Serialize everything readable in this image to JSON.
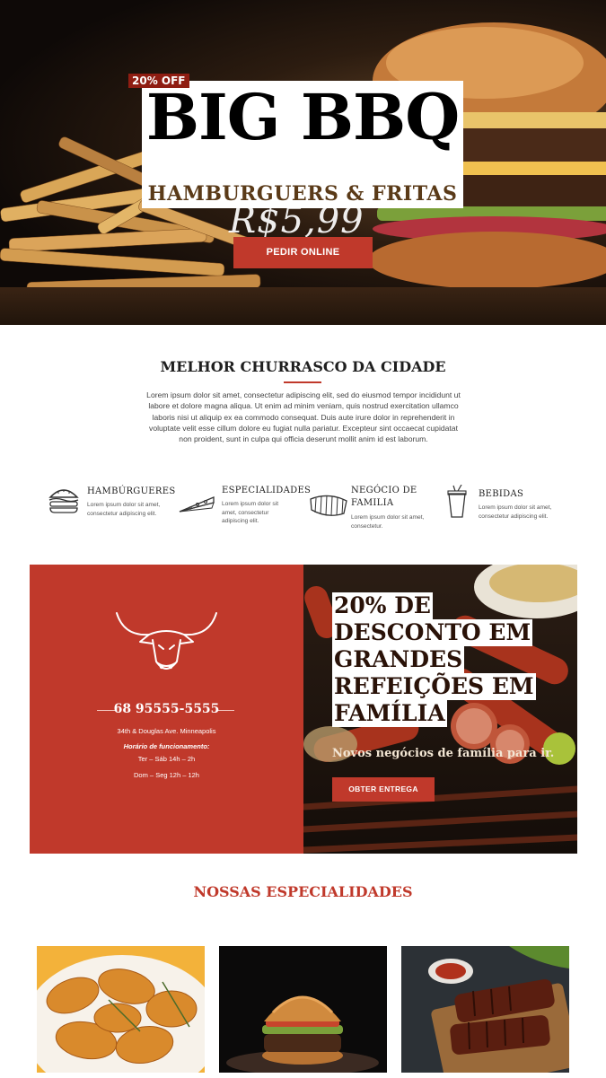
{
  "hero": {
    "badge": "20% OFF",
    "title": "BIG BBQ",
    "subtitle": "HAMBURGUERS & FRITAS",
    "price": "R$5,99",
    "button": "PEDIR ONLINE"
  },
  "intro": {
    "title": "MELHOR CHURRASCO DA CIDADE",
    "text": "Lorem ipsum dolor sit amet, consectetur adipiscing elit, sed do eiusmod tempor incididunt ut labore et dolore magna aliqua. Ut enim ad minim veniam, quis nostrud exercitation ullamco laboris nisi ut aliquip ex ea commodo consequat. Duis aute irure dolor in reprehenderit in voluptate velit esse cillum dolore eu fugiat nulla pariatur. Excepteur sint occaecat cupidatat non proident, sunt in culpa qui officia deserunt mollit anim id est laborum."
  },
  "features": [
    {
      "icon": "burger-icon",
      "title": "HAMBÚRGUERES",
      "text": "Lorem ipsum dolor sit amet, consectetur adipiscing elit."
    },
    {
      "icon": "pizza-slice-icon",
      "title": "ESPECIALIDADES",
      "text": "Lorem ipsum dolor sit amet, consectetur adipiscing elit."
    },
    {
      "icon": "ribs-icon",
      "title": "NEGÓCIO DE FAMILIA",
      "text": "Lorem ipsum dolor sit amet, consectetur."
    },
    {
      "icon": "drink-cup-icon",
      "title": "BEBIDAS",
      "text": "Lorem ipsum dolor sit amet, consectetur adipiscing elit."
    }
  ],
  "promo": {
    "logo_icon": "bull-head-icon",
    "phone": "68 95555-5555",
    "address": "34th & Douglas Ave. Minneapolis",
    "hours_label": "Horário de funcionamento:",
    "hours_1": "Ter – Sáb  14h – 2h",
    "hours_2": "Dom –  Seg 12h – 12h",
    "headline_lines": [
      "20% DE",
      "DESCONTO EM",
      "GRANDES",
      "REFEIÇÕES EM",
      "FAMÍLIA"
    ],
    "subtext": "Novos negócios de família para ir.",
    "button": "OBTER ENTREGA"
  },
  "specialties": {
    "title": "NOSSAS ESPECIALIDADES"
  },
  "colors": {
    "accent": "#c0392b",
    "dark": "#1f1f1f"
  }
}
